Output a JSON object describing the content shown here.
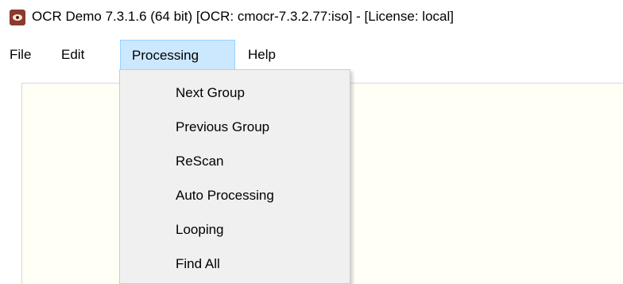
{
  "window": {
    "title": "OCR Demo 7.3.1.6 (64 bit) [OCR: cmocr-7.3.2.77:iso] - [License: local]",
    "icon": "app-eye-icon"
  },
  "menubar": {
    "items": [
      {
        "label": "File"
      },
      {
        "label": "Edit"
      },
      {
        "label": "Processing",
        "active": true
      },
      {
        "label": "Help"
      }
    ]
  },
  "processing_menu": {
    "items": [
      {
        "label": "Next Group"
      },
      {
        "label": "Previous Group"
      },
      {
        "label": "ReScan"
      },
      {
        "label": "Auto Processing"
      },
      {
        "label": "Looping"
      },
      {
        "label": "Find All"
      }
    ]
  },
  "colors": {
    "menu_highlight": "#cce8ff",
    "menu_highlight_border": "#99d1ff",
    "dropdown_bg": "#f0f0f0",
    "content_bg": "#fffff6"
  }
}
